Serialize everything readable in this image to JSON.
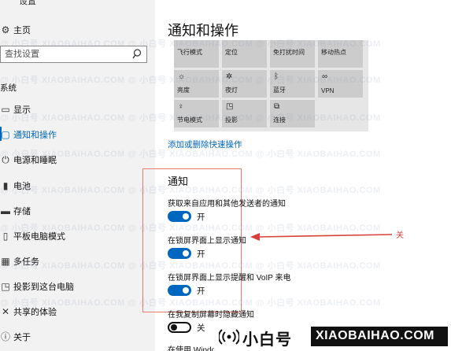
{
  "window": {
    "title": "设置"
  },
  "sidebar": {
    "home_label": "主页",
    "search_placeholder": "查找设置",
    "section_label": "系统",
    "items": [
      {
        "label": "显示",
        "icon": "monitor-icon"
      },
      {
        "label": "通知和操作",
        "icon": "notification-icon",
        "active": true
      },
      {
        "label": "电源和睡眠",
        "icon": "power-icon"
      },
      {
        "label": "电池",
        "icon": "battery-icon"
      },
      {
        "label": "存储",
        "icon": "storage-icon"
      },
      {
        "label": "平板电脑模式",
        "icon": "tablet-icon"
      },
      {
        "label": "多任务",
        "icon": "multitask-icon"
      },
      {
        "label": "投影到这台电脑",
        "icon": "project-icon"
      },
      {
        "label": "共享的体验",
        "icon": "share-icon"
      },
      {
        "label": "关于",
        "icon": "info-icon"
      }
    ]
  },
  "main": {
    "title": "通知和操作",
    "quick_actions": [
      {
        "label": "飞行模式",
        "icon": ""
      },
      {
        "label": "定位",
        "icon": ""
      },
      {
        "label": "免打扰时间",
        "icon": ""
      },
      {
        "label": "移动热点",
        "icon": ""
      },
      {
        "label": "亮度",
        "icon": "brightness-icon"
      },
      {
        "label": "夜灯",
        "icon": "night-light-icon"
      },
      {
        "label": "蓝牙",
        "icon": "bluetooth-icon"
      },
      {
        "label": "VPN",
        "icon": "vpn-icon"
      },
      {
        "label": "节电模式",
        "icon": "battery-saver-icon"
      },
      {
        "label": "投影",
        "icon": "project-icon"
      },
      {
        "label": "连接",
        "icon": "connect-icon"
      }
    ],
    "edit_link": "添加或删除快速操作",
    "notifications": {
      "heading": "通知",
      "options": [
        {
          "label": "获取来自应用和其他发送者的通知",
          "state": "开",
          "on": true
        },
        {
          "label": "在锁屏界面上显示通知",
          "state": "开",
          "on": true
        },
        {
          "label": "在锁屏界面上显示提醒和 VoIP 来电",
          "state": "开",
          "on": true
        },
        {
          "label": "在我复制屏幕时隐藏通知",
          "state": "关",
          "on": false
        },
        {
          "label": "在使用 Windo",
          "state": "",
          "on": null
        }
      ]
    },
    "annotation": "关"
  },
  "watermark": {
    "row_text": "@ 小白号  XIAOBAIHAO.COM    @ 小白号  XIAOBAIHAO.COM    @ 小白号  XIAOBAIHAO.COM",
    "badge_cn": "小白号",
    "badge_en": "XIAOBAIHAO.COM"
  },
  "colors": {
    "accent": "#0067c0",
    "annotation": "#d8413a",
    "tile": "#cccccc",
    "sidebar_bg": "#f2f2f2"
  }
}
